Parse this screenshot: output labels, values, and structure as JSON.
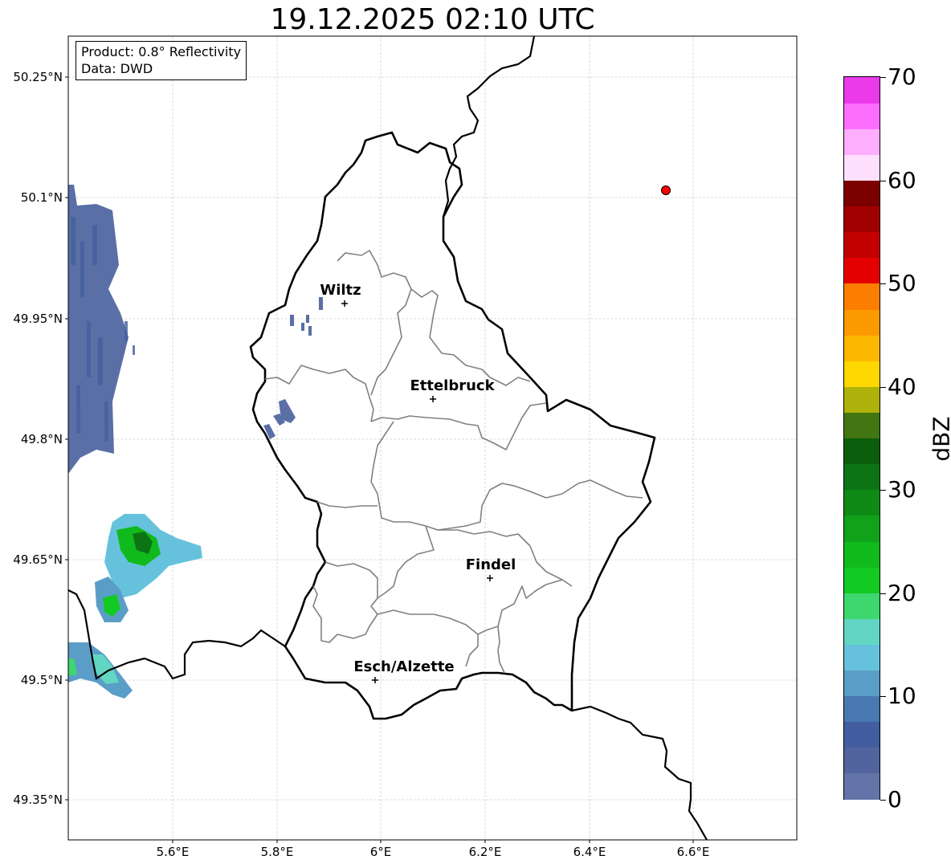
{
  "title": "19.12.2025 02:10 UTC",
  "infobox": {
    "product": "Product: 0.8° Reflectivity",
    "source": "Data: DWD"
  },
  "map": {
    "lon_range": [
      5.4,
      6.8
    ],
    "lat_range": [
      49.3,
      50.28
    ],
    "lat_ticks": [
      {
        "value": 50.25,
        "label": "50.25°N"
      },
      {
        "value": 50.1,
        "label": "50.1°N"
      },
      {
        "value": 49.95,
        "label": "49.95°N"
      },
      {
        "value": 49.8,
        "label": "49.8°N"
      },
      {
        "value": 49.65,
        "label": "49.65°N"
      },
      {
        "value": 49.5,
        "label": "49.5°N"
      },
      {
        "value": 49.35,
        "label": "49.35°N"
      }
    ],
    "lon_ticks": [
      {
        "value": 5.6,
        "label": "5.6°E"
      },
      {
        "value": 5.8,
        "label": "5.8°E"
      },
      {
        "value": 6.0,
        "label": "6°E"
      },
      {
        "value": 6.2,
        "label": "6.2°E"
      },
      {
        "value": 6.4,
        "label": "6.4°E"
      },
      {
        "value": 6.6,
        "label": "6.6°E"
      }
    ],
    "cities": [
      {
        "name": "Wiltz",
        "lon": 5.93,
        "lat": 49.967
      },
      {
        "name": "Ettelbruck",
        "lon": 6.1,
        "lat": 49.848
      },
      {
        "name": "Findel",
        "lon": 6.21,
        "lat": 49.626
      },
      {
        "name": "Esch/Alzette",
        "lon": 5.99,
        "lat": 49.499
      }
    ],
    "radar_site": {
      "lon": 6.548,
      "lat": 50.111,
      "color": "#ff0000"
    }
  },
  "colorbar": {
    "unit": "dBZ",
    "min": 0,
    "max": 70,
    "ticks": [
      "0",
      "10",
      "20",
      "30",
      "40",
      "50",
      "60",
      "70"
    ],
    "colors": [
      "#6474a8",
      "#52649e",
      "#425ea0",
      "#4a78b0",
      "#5a9ec8",
      "#66c2dc",
      "#62d6c2",
      "#3ed66e",
      "#12ca22",
      "#10ba1c",
      "#10a21a",
      "#0e8a16",
      "#0c7414",
      "#0a5e0c",
      "#427612",
      "#aeb20a",
      "#fed600",
      "#fcb800",
      "#fc9a00",
      "#fc7e00",
      "#e40000",
      "#c20000",
      "#a00000",
      "#7c0000",
      "#fee0fe",
      "#feaefe",
      "#fe6efe",
      "#ea3aea"
    ]
  }
}
